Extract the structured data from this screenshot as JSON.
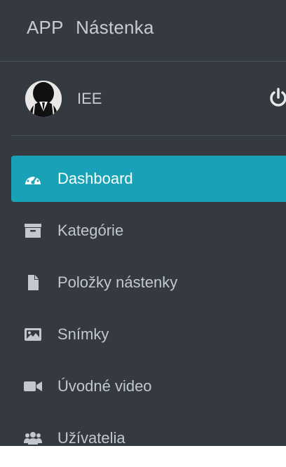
{
  "brand": {
    "app": "APP",
    "name": "Nástenka"
  },
  "user": {
    "name": "IEE"
  },
  "nav": {
    "items": [
      {
        "label": "Dashboard",
        "icon": "tachometer-icon",
        "active": true
      },
      {
        "label": "Kategórie",
        "icon": "archive-icon"
      },
      {
        "label": "Položky nástenky",
        "icon": "file-icon"
      },
      {
        "label": "Snímky",
        "icon": "image-icon"
      },
      {
        "label": "Úvodné video",
        "icon": "video-camera-icon"
      },
      {
        "label": "Užívatelia",
        "icon": "users-icon"
      }
    ]
  },
  "colors": {
    "sidebar_bg": "#343a40",
    "active_bg": "#17a2b8",
    "text": "#c2c7d0"
  }
}
